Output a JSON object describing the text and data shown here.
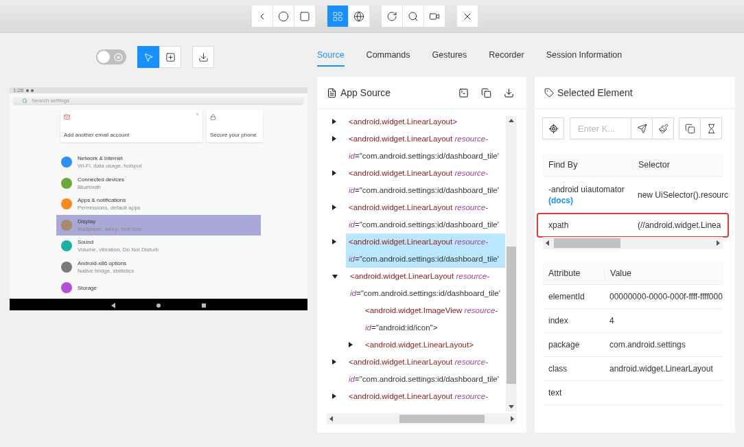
{
  "device_controls": [
    {
      "buttons": [
        {
          "selected": false
        },
        {
          "selected": false
        },
        {
          "selected": false
        }
      ]
    },
    {
      "buttons": [
        {
          "selected": true
        },
        {
          "selected": false
        }
      ]
    },
    {
      "buttons": [
        {
          "selected": false
        },
        {
          "selected": false
        },
        {
          "selected": false
        }
      ]
    },
    {
      "buttons": [
        {
          "selected": false
        }
      ]
    }
  ],
  "inspector_toolbar": {
    "toggle": {
      "on": false
    },
    "modes": [
      {
        "selected": true
      },
      {
        "selected": false
      }
    ]
  },
  "device_screen": {
    "status_time": "1:28",
    "search_placeholder": "Search settings",
    "cards": [
      {
        "title": "Add another email account",
        "closable": true
      },
      {
        "title": "Secure your phone",
        "closable": false
      }
    ],
    "items": [
      {
        "title": "Network & internet",
        "subtitle": "Wi-Fi, data usage, hotspot",
        "color": "#2f8ff0",
        "selected": false
      },
      {
        "title": "Connected devices",
        "subtitle": "Bluetooth",
        "color": "#6aa83a",
        "selected": false
      },
      {
        "title": "Apps & notifications",
        "subtitle": "Permissions, default apps",
        "color": "#f58a1f",
        "selected": false
      },
      {
        "title": "Display",
        "subtitle": "Wallpaper, sleep, font size",
        "color": "#a8896a",
        "selected": true
      },
      {
        "title": "Sound",
        "subtitle": "Volume, vibration, Do Not Disturb",
        "color": "#19b2a0",
        "selected": false
      },
      {
        "title": "Android-x86 options",
        "subtitle": "Native bridge, statistics",
        "color": "#7a7a7a",
        "selected": false
      },
      {
        "title": "Storage",
        "color": "#b24fd6",
        "selected": false
      }
    ]
  },
  "tabs": [
    {
      "label": "Source",
      "selected": true
    },
    {
      "label": "Commands",
      "selected": false
    },
    {
      "label": "Gestures",
      "selected": false
    },
    {
      "label": "Recorder",
      "selected": false
    },
    {
      "label": "Session Information",
      "selected": false
    }
  ],
  "app_source": {
    "title": "App Source",
    "tree": [
      {
        "kind": "branch",
        "expanded": false,
        "selected": false,
        "tag": "<android.widget.LinearLayout>"
      },
      {
        "kind": "branch",
        "expanded": false,
        "selected": false,
        "tag": "<android.widget.LinearLayout",
        "attr": "resource-id",
        "value": "=\"com.android.settings:id/dashboard_tile'"
      },
      {
        "kind": "branch",
        "expanded": false,
        "selected": false,
        "tag": "<android.widget.LinearLayout",
        "attr": "resource-id",
        "value": "=\"com.android.settings:id/dashboard_tile'"
      },
      {
        "kind": "branch",
        "expanded": false,
        "selected": false,
        "tag": "<android.widget.LinearLayout",
        "attr": "resource-id",
        "value": "=\"com.android.settings:id/dashboard_tile'"
      },
      {
        "kind": "branch",
        "expanded": false,
        "selected": true,
        "tag": "<android.widget.LinearLayout",
        "attr": "resource-id",
        "value": "=\"com.android.settings:id/dashboard_tile'"
      },
      {
        "kind": "branch",
        "expanded": true,
        "selected": false,
        "tag": "<android.widget.LinearLayout",
        "attr": "resource-id",
        "value": "=\"com.android.settings:id/dashboard_tile'",
        "children": [
          {
            "kind": "leaf",
            "selected": false,
            "tag": "<android.widget.ImageView",
            "attr": "resource-id",
            "value": "=\"android:id/icon\">"
          },
          {
            "kind": "branch",
            "expanded": false,
            "selected": false,
            "tag": "<android.widget.LinearLayout>"
          }
        ]
      },
      {
        "kind": "branch",
        "expanded": false,
        "selected": false,
        "tag": "<android.widget.LinearLayout",
        "attr": "resource-id",
        "value": "=\"com.android.settings:id/dashboard_tile'"
      },
      {
        "kind": "branch",
        "expanded": false,
        "selected": false,
        "tag": "<android.widget.LinearLayout",
        "attr": "resource-"
      }
    ]
  },
  "selected_element": {
    "title": "Selected Element",
    "input_placeholder": "Enter K...",
    "selectors": {
      "columns": [
        "Find By",
        "Selector"
      ],
      "rows": [
        {
          "find_by": "-android uiautomator",
          "link": "(docs)",
          "selector": "new UiSelector().resourc",
          "highlighted": false
        },
        {
          "find_by": "xpath",
          "selector": "(//android.widget.Linea",
          "highlighted": true
        }
      ]
    },
    "attributes": {
      "columns": [
        "Attribute",
        "Value"
      ],
      "rows": [
        {
          "name": "elementId",
          "value": "00000000-0000-000f-ffff-ffff000"
        },
        {
          "name": "index",
          "value": "4"
        },
        {
          "name": "package",
          "value": "com.android.settings"
        },
        {
          "name": "class",
          "value": "android.widget.LinearLayout"
        },
        {
          "name": "text"
        }
      ]
    }
  }
}
